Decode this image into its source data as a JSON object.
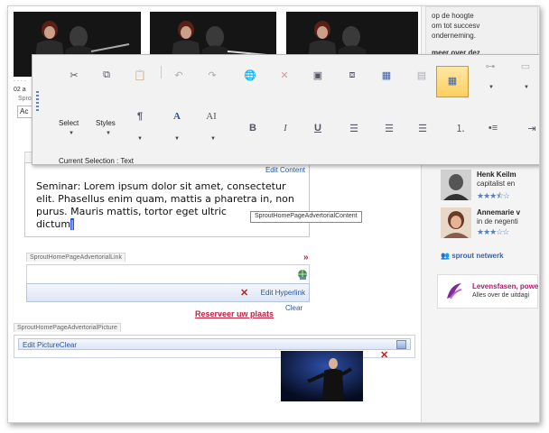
{
  "meta": {
    "accent": "#2a56a0",
    "warning_red": "#c02040"
  },
  "hero": {
    "date_fragment": "02 a",
    "tab_fragment": "Sprou",
    "field_fragment": "Ac"
  },
  "right": {
    "top_text": [
      "op de hoogte",
      "om tot succesv",
      "onderneming."
    ],
    "more_link": "meer over dez",
    "people": [
      {
        "name": "Henk Keilm",
        "desc": "capitalist en",
        "rating": 3.5
      },
      {
        "name": "Annemarie v",
        "desc": "in de negenti",
        "rating": 3
      }
    ],
    "network": "sprout netwerk",
    "lifephase_title": "Levensfasen, powe",
    "lifephase_sub": "Alles over de uitdagi"
  },
  "toolbar": {
    "select_label": "Select",
    "styles_label": "Styles",
    "current_selection": "Current Selection : Text",
    "bold": "B",
    "italic": "I",
    "underline": "U",
    "font_color": "A",
    "font_size": "AI",
    "paragraph": "¶"
  },
  "editor": {
    "content_field_label": "SproutHomePageAdvertorialContent",
    "edit_content": "Edit Content",
    "content_text": "Seminar: Lorem ipsum dolor sit amet, consectetur elit. Phasellus enim quam, mattis a pharetra in, non purus. Mauris mattis, tortor eget ultric",
    "content_tail": "dictum",
    "content_cursor": "|",
    "tooltip": "SproutHomePageAdvertorialContent",
    "link_field_label": "SproutHomePageAdvertorialLink",
    "double_arrow": "»",
    "edit_hyperlink": "Edit Hyperlink",
    "clear": "Clear",
    "reserve_link": "Reserveer uw plaats",
    "picture_field_label": "SproutHomePageAdvertorialPicture",
    "edit_picture": "Edit PictureClear"
  }
}
